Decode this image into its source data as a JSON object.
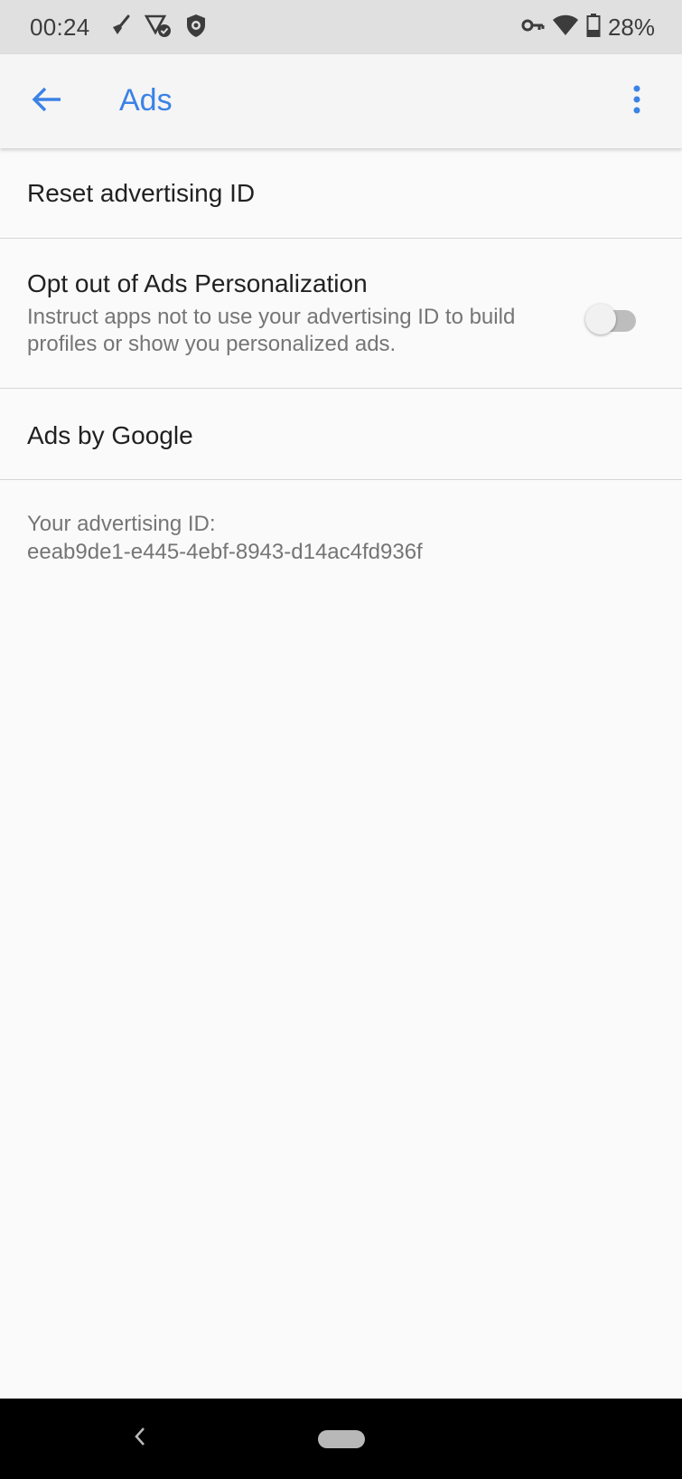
{
  "status_bar": {
    "time": "00:24",
    "left_icons": [
      "broom-icon",
      "signal-check-icon",
      "lion-shield-icon"
    ],
    "right_icons": [
      "vpn-key-icon",
      "wifi-icon",
      "battery-icon"
    ],
    "battery_text": "28%"
  },
  "app_bar": {
    "title": "Ads",
    "back_icon": "arrow-back-icon",
    "menu_icon": "more-vert-icon"
  },
  "settings": {
    "reset_label": "Reset advertising ID",
    "optout_title": "Opt out of Ads Personalization",
    "optout_summary": "Instruct apps not to use your advertising ID to build profiles or show you personalized ads.",
    "optout_enabled": false,
    "ads_by_google_label": "Ads by Google",
    "adid_label": "Your advertising ID:",
    "adid_value": "eeab9de1-e445-4ebf-8943-d14ac4fd936f"
  },
  "nav_bar": {
    "back_icon": "nav-back-icon",
    "home_icon": "nav-home-pill-icon"
  },
  "colors": {
    "accent": "#3b82e6",
    "status_bar_bg": "#e0e0e0",
    "app_bar_bg": "#f5f5f5",
    "background": "#fafafa",
    "nav_bar_bg": "#000000"
  }
}
